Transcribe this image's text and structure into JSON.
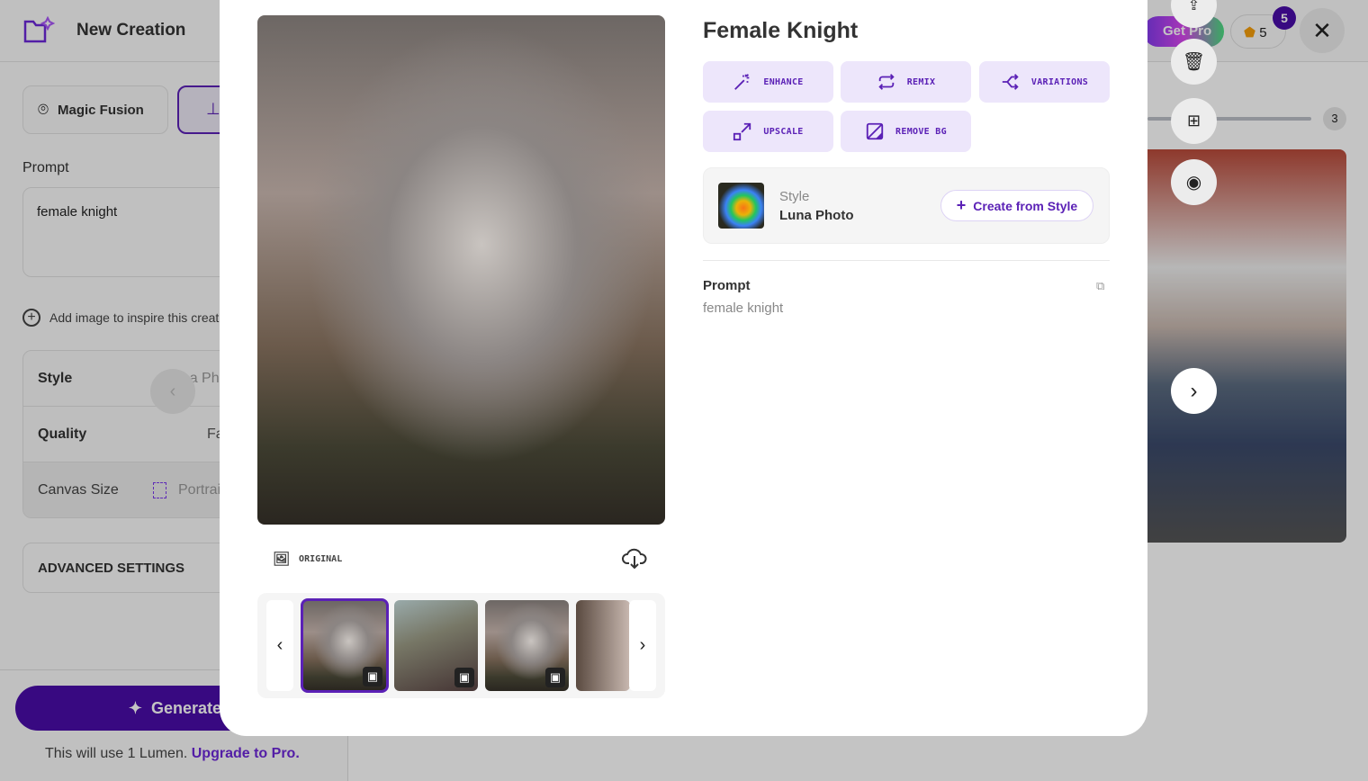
{
  "app": {
    "title": "New Creation"
  },
  "sidebar": {
    "magic_fusion": "Magic Fusion",
    "prompt_label": "Prompt",
    "prompt_value": "female knight",
    "add_image": "Add image to inspire this creation",
    "settings": [
      {
        "label": "Style",
        "value": "Luna Photo"
      },
      {
        "label": "Quality",
        "value": "Fast"
      },
      {
        "label": "Canvas Size",
        "value": "Portrait"
      }
    ],
    "advanced": "ADVANCED SETTINGS",
    "generate": "Generate",
    "usage_text": "This will use 1 Lumen.",
    "upgrade_link": "Upgrade to Pro."
  },
  "header": {
    "get_pro": "Get Pro",
    "credits": "5",
    "notification_count": "5"
  },
  "gallery": {
    "count": "3"
  },
  "modal": {
    "title": "Female Knight",
    "actions": [
      {
        "label": "ENHANCE",
        "icon": "magic-wand-icon"
      },
      {
        "label": "REMIX",
        "icon": "repeat-icon"
      },
      {
        "label": "VARIATIONS",
        "icon": "split-arrows-icon"
      },
      {
        "label": "UPSCALE",
        "icon": "upscale-icon"
      },
      {
        "label": "REMOVE BG",
        "icon": "remove-bg-icon"
      }
    ],
    "style_label": "Style",
    "style_name": "Luna Photo",
    "create_from_style": "Create from Style",
    "prompt_label": "Prompt",
    "prompt_value": "female knight",
    "original_label": "ORIGINAL"
  },
  "colors": {
    "accent": "#5b21b6",
    "accent_bg": "#ede6fb",
    "generate": "#4a0ca8"
  }
}
